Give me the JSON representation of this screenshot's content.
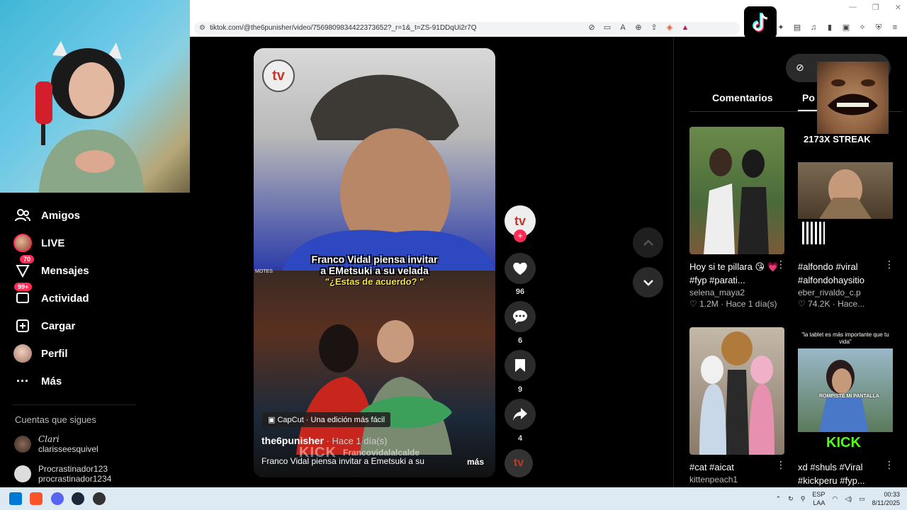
{
  "browser": {
    "url": "tiktok.com/@the6punisher/video/7569809834422373652?_r=1&_t=ZS-91DDqUi2r7Q"
  },
  "nav": {
    "items": [
      {
        "label": "Amigos"
      },
      {
        "label": "LIVE"
      },
      {
        "label": "Mensajes",
        "badge": "70"
      },
      {
        "label": "Actividad",
        "badge": "99+"
      },
      {
        "label": "Cargar"
      },
      {
        "label": "Perfil"
      },
      {
        "label": "Más"
      }
    ],
    "following_title": "Cuentas que sigues",
    "following": [
      {
        "display": "Clari",
        "handle": "clarisseesquivel"
      },
      {
        "display": "Procrastinador123",
        "handle": "procrastinador1234"
      }
    ]
  },
  "video": {
    "caption_line1": "Franco Vidal piensa invitar",
    "caption_line2": "a EMetsuki a su velada",
    "caption_question": "\"¿Estas de acuerdo? \"",
    "side_tag": "MOTES",
    "capcut": "CapCut · Una edición más fácil",
    "author": "the6punisher",
    "time": " · Hace 1 día(s)",
    "watermark_kick": "KICK",
    "watermark_name": "Francovidalalcalde",
    "description": "Franco Vidal piensa invitar a Emetsuki a su",
    "more": "más",
    "likes": "96",
    "comments": "6",
    "saves": "9",
    "shares": "4"
  },
  "right": {
    "tabs": [
      "Comentarios",
      "Po"
    ],
    "meme_text": "2173X STREAK",
    "cards": [
      {
        "title": "Hoy si te pillara 😘 💗#fyp #parati...",
        "user": "selena_maya2",
        "likes": "1.2M",
        "time": "Hace 1 día(s)"
      },
      {
        "title": "#alfondo #viral #alfondohaysitio",
        "user": "eber_rivaldo_c.p",
        "likes": "74.2K",
        "time": "Hace..."
      },
      {
        "title": "#cat #aicat",
        "user": "kittenpeach1",
        "likes": "",
        "time": ""
      },
      {
        "title": "xd #shuls #Viral #kickperu #fyp...",
        "user": "",
        "likes": "",
        "time": "",
        "overlay": "\"la tablet es más importante que tu vida\"",
        "overlay2": "ROMPISTE MI PANTALLA",
        "overlay3": "KICK"
      }
    ]
  },
  "taskbar": {
    "lang1": "ESP",
    "lang2": "LAA",
    "time": "00:33",
    "date": "8/11/2025"
  },
  "colors": {
    "accent": "#fe2c55",
    "taskbar": "#dde9f3"
  }
}
